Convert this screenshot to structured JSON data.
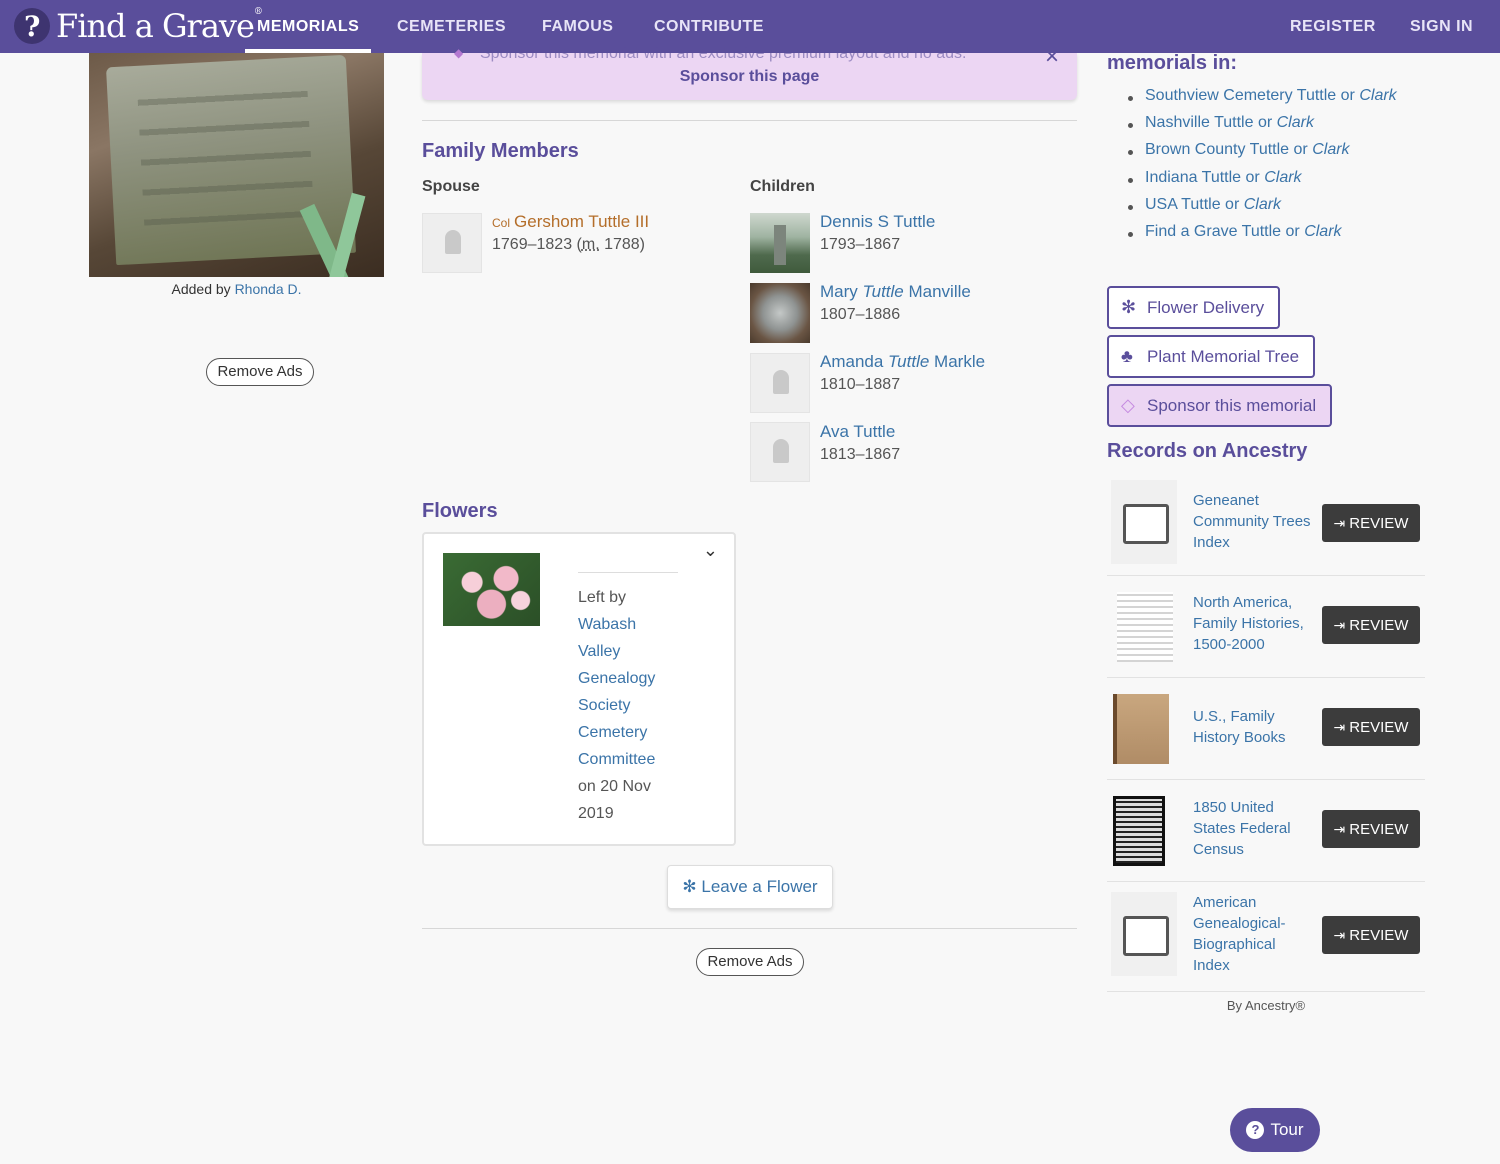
{
  "nav": {
    "logo_text": "Find a Grave",
    "logo_reg": "®",
    "items": [
      "Memorials",
      "Cemeteries",
      "Famous",
      "Contribute"
    ],
    "register": "Register",
    "sign_in": "Sign In"
  },
  "left": {
    "added_by_prefix": "Added by ",
    "added_by_user": "Rhonda D.",
    "remove_ads": "Remove Ads"
  },
  "sponsor_banner": {
    "faded_text": "Sponsor this memorial with an exclusive premium layout and no ads.",
    "link": "Sponsor this page",
    "close": "×"
  },
  "family": {
    "title": "Family Members",
    "spouse_label": "Spouse",
    "children_label": "Children",
    "spouse": {
      "prefix": "Col",
      "name": "Gershom Tuttle III",
      "dates_a": "1769–1823 (",
      "abbr": "m.",
      "dates_b": " 1788)"
    },
    "children": [
      {
        "first": "Dennis S Tuttle",
        "maiden": "",
        "last": "",
        "dates": "1793–1867"
      },
      {
        "first": "Mary ",
        "maiden": "Tuttle",
        "last": " Manville",
        "dates": "1807–1886"
      },
      {
        "first": "Amanda ",
        "maiden": "Tuttle",
        "last": " Markle",
        "dates": "1810–1887"
      },
      {
        "first": "Ava Tuttle",
        "maiden": "",
        "last": "",
        "dates": "1813–1867"
      }
    ]
  },
  "flowers": {
    "title": "Flowers",
    "left_by": "Left by",
    "org_lines": [
      "Wabash",
      "Valley",
      "Genealogy",
      "Society",
      "Cemetery",
      "Committee"
    ],
    "date_lines": [
      "on 20 Nov",
      "2019"
    ],
    "chevron": "⌄",
    "leave_flower": "Leave a Flower",
    "remove_ads": "Remove Ads"
  },
  "right": {
    "memorials_in": "memorials in:",
    "searches": [
      {
        "place": "Southview Cemetery Tuttle",
        "alt": "Clark"
      },
      {
        "place": "Nashville Tuttle",
        "alt": "Clark"
      },
      {
        "place": "Brown County Tuttle",
        "alt": "Clark"
      },
      {
        "place": "Indiana Tuttle",
        "alt": "Clark"
      },
      {
        "place": "USA Tuttle",
        "alt": "Clark"
      },
      {
        "place": "Find a Grave Tuttle",
        "alt": "Clark"
      }
    ],
    "or": " or ",
    "flower_delivery": "Flower Delivery",
    "plant_tree": "Plant Memorial Tree",
    "sponsor_memorial": "Sponsor this memorial",
    "records_title": "Records on Ancestry",
    "records": [
      {
        "lines": [
          "Geneanet",
          "Community Trees",
          "Index"
        ],
        "thumb": "placeholder"
      },
      {
        "lines": [
          "North America,",
          "Family Histories,",
          "1500-2000"
        ],
        "thumb": "doc1"
      },
      {
        "lines": [
          "U.S., Family",
          "History Books"
        ],
        "thumb": "doc2"
      },
      {
        "lines": [
          "1850 United",
          "States Federal",
          "Census"
        ],
        "thumb": "doc3"
      },
      {
        "lines": [
          "American",
          "Genealogical-",
          "Biographical",
          "Index"
        ],
        "thumb": "placeholder"
      }
    ],
    "review": "REVIEW",
    "by_ancestry": "By Ancestry®"
  },
  "tour": "Tour",
  "colors": {
    "brand": "#5a4e9b",
    "link": "#3b74a8",
    "sponsor_bg": "#ecd6f3",
    "spouse": "#b46e2a"
  }
}
